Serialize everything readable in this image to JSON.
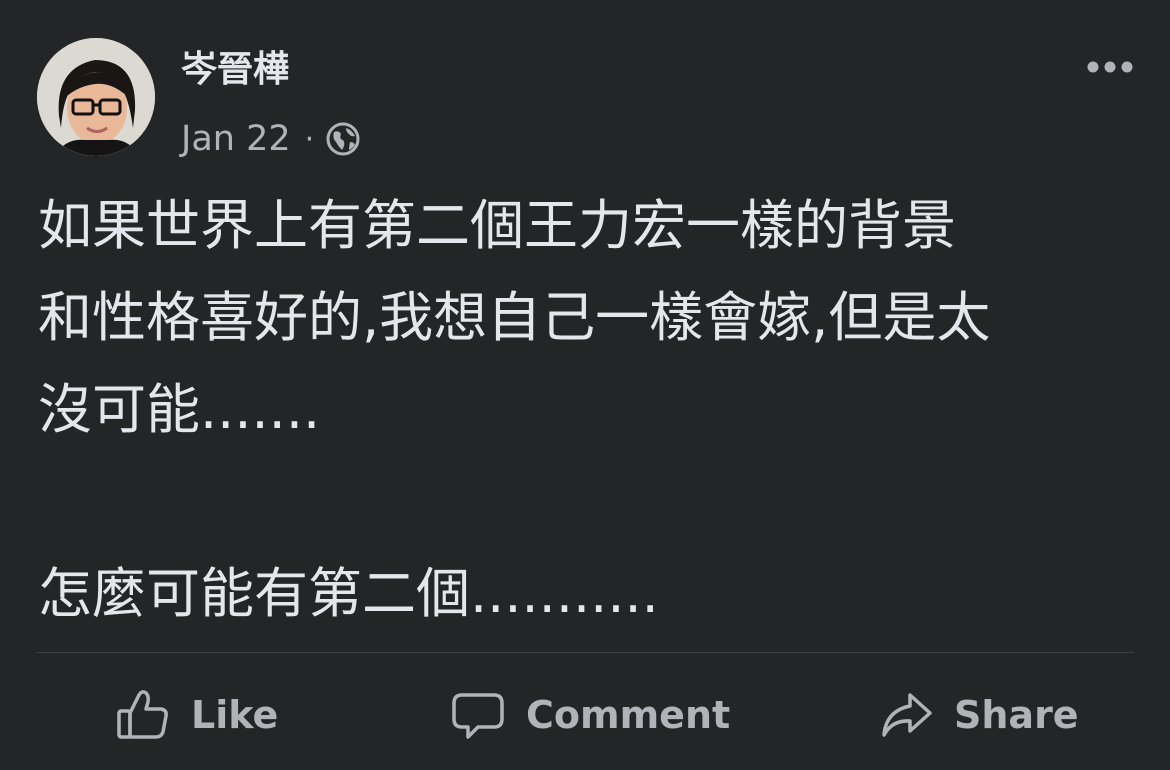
{
  "post": {
    "author": "岑晉樺",
    "date": "Jan 22",
    "separator": "·",
    "privacy_icon": "globe-icon",
    "more_icon": "more-horizontal-icon",
    "text_lines": [
      "如果世界上有第二個王力宏一樣的背景",
      "和性格喜好的,我想自己一樣會嫁,但是太",
      "沒可能.......",
      "",
      "怎麼可能有第二個..........."
    ]
  },
  "actions": {
    "like_label": "Like",
    "like_icon": "thumbs-up-icon",
    "comment_label": "Comment",
    "comment_icon": "speech-bubble-icon",
    "share_label": "Share",
    "share_icon": "share-arrow-icon"
  },
  "colors": {
    "background": "#242526",
    "primary_text": "#e4e6eb",
    "secondary_text": "#b0b3b8",
    "divider": "#3e4042"
  }
}
